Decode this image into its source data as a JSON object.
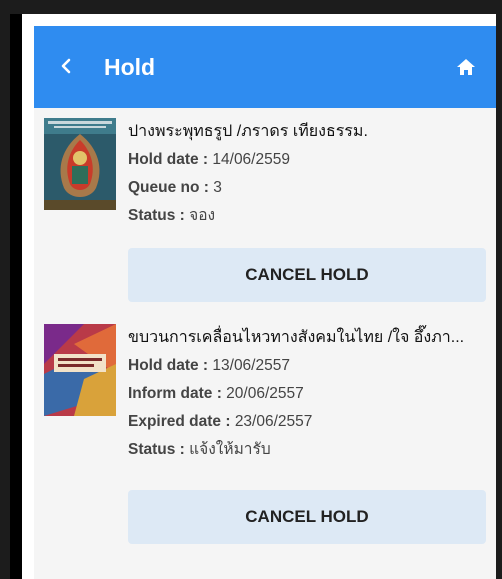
{
  "header": {
    "title": "Hold",
    "back_icon": "chevron-left-icon",
    "home_icon": "home-icon",
    "color": "#2f8cf0"
  },
  "holds": [
    {
      "title": "ปางพระพุทธรูป /ภราดร เทียงธรรม.",
      "fields": [
        {
          "label": "Hold date : ",
          "value": "14/06/2559"
        },
        {
          "label": "Queue no : ",
          "value": "3"
        },
        {
          "label": "Status : ",
          "value": "จอง"
        }
      ],
      "button": "CANCEL HOLD"
    },
    {
      "title": "ขบวนการเคลื่อนไหวทางสังคมในไทย /ใจ อึ๊งภา...",
      "fields": [
        {
          "label": "Hold date : ",
          "value": "13/06/2557"
        },
        {
          "label": "Inform date : ",
          "value": "20/06/2557"
        },
        {
          "label": "Expired date : ",
          "value": "23/06/2557"
        },
        {
          "label": "Status : ",
          "value": "แจ้งให้มารับ"
        }
      ],
      "button": "CANCEL HOLD"
    }
  ]
}
